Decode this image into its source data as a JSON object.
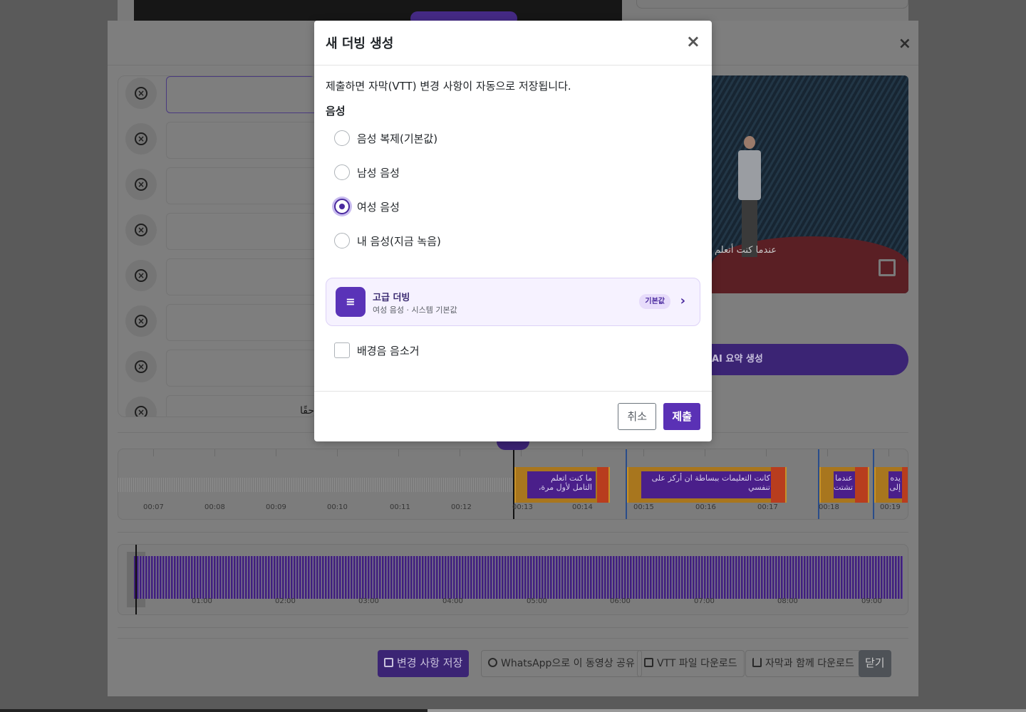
{
  "dialog": {
    "title": "새 더빙 생성",
    "close_glyph": "×",
    "note": "제출하면 자막(VTT) 변경 사항이 자동으로 저장됩니다.",
    "voice_label": "음성",
    "voice_options": [
      {
        "label": "음성 복제(기본값)",
        "checked": false
      },
      {
        "label": "남성 음성",
        "checked": false
      },
      {
        "label": "여성 음성",
        "checked": true
      },
      {
        "label": "내 음성(지금 녹음)",
        "checked": false
      }
    ],
    "advanced": {
      "icon": "≡",
      "title": "고급 더빙",
      "subtitle": "여성 음성 · 시스템 기본값",
      "badge": "기본값",
      "chevron": "›"
    },
    "mute_bgm_label": "배경음 음소거",
    "mute_bgm_checked": false,
    "cancel_label": "취소",
    "submit_label": "제출"
  },
  "editor": {
    "close_glyph": "×",
    "segment_remove_glyph": "×",
    "segment_partial_text": "حقًا",
    "video_caption": "عندما كنت أتعلم",
    "summary_button": "AI 요약 생성",
    "timeline": {
      "labels": [
        "00:07",
        "00:08",
        "00:09",
        "00:10",
        "00:11",
        "00:12",
        "00:13",
        "00:14",
        "00:15",
        "00:16",
        "00:17",
        "00:18",
        "00:19"
      ],
      "subtitles": [
        "ما كنت اتعلم التامل لأول مرة،",
        "كانت التعليمات ببساطة ان أركز على تنفسي",
        "عندما تشتت",
        "يده إلى"
      ]
    },
    "overview_labels": [
      "01:00",
      "02:00",
      "03:00",
      "04:00",
      "05:00",
      "06:00",
      "07:00",
      "08:00",
      "09:00"
    ],
    "footer": {
      "save": "변경 사항 저장",
      "whatsapp": "WhatsApp으로 이 동영상 공유",
      "vtt": "VTT 파일 다운로드",
      "download_sub": "자막과 함께 다운로드",
      "close": "닫기"
    }
  },
  "colors": {
    "accent": "#5a31b5",
    "badge_bg": "#e7dcfb",
    "card_bg": "#f6f2ff"
  }
}
